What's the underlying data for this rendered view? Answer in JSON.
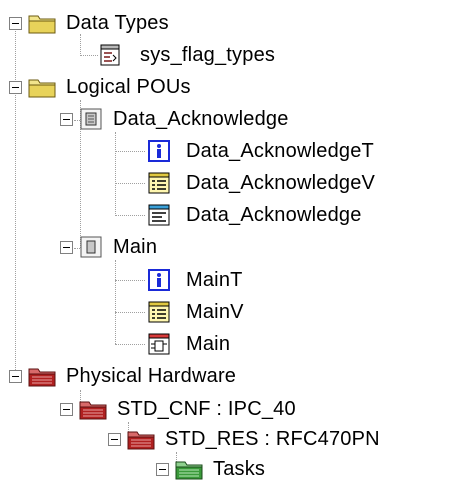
{
  "tree": {
    "data_types": {
      "label": "Data Types",
      "icon": "folder-icon",
      "children": [
        {
          "label": "sys_flag_types",
          "icon": "type-file-icon"
        }
      ]
    },
    "logical_pous": {
      "label": "Logical POUs",
      "icon": "folder-icon",
      "data_acknowledge": {
        "label": "Data_Acknowledge",
        "icon": "pou-group-icon",
        "children": [
          {
            "label": "Data_AcknowledgeT",
            "icon": "info-icon"
          },
          {
            "label": "Data_AcknowledgeV",
            "icon": "variables-icon"
          },
          {
            "label": "Data_Acknowledge",
            "icon": "code-icon"
          }
        ]
      },
      "main": {
        "label": "Main",
        "icon": "pou-group-icon",
        "children": [
          {
            "label": "MainT",
            "icon": "info-icon"
          },
          {
            "label": "MainV",
            "icon": "variables-icon"
          },
          {
            "label": "Main",
            "icon": "function-block-icon"
          }
        ]
      }
    },
    "physical_hardware": {
      "label": "Physical Hardware",
      "icon": "hardware-folder-icon",
      "configuration": {
        "label": "STD_CNF : IPC_40",
        "icon": "hardware-folder-icon",
        "resource": {
          "label": "STD_RES : RFC470PN",
          "icon": "hardware-folder-icon",
          "tasks": {
            "label": "Tasks",
            "icon": "tasks-folder-icon"
          }
        }
      }
    }
  },
  "colors": {
    "folder": "#e8d87a",
    "hardware": "#b02020",
    "tasks": "#3a9a3a",
    "info": "#1a2ad8"
  }
}
